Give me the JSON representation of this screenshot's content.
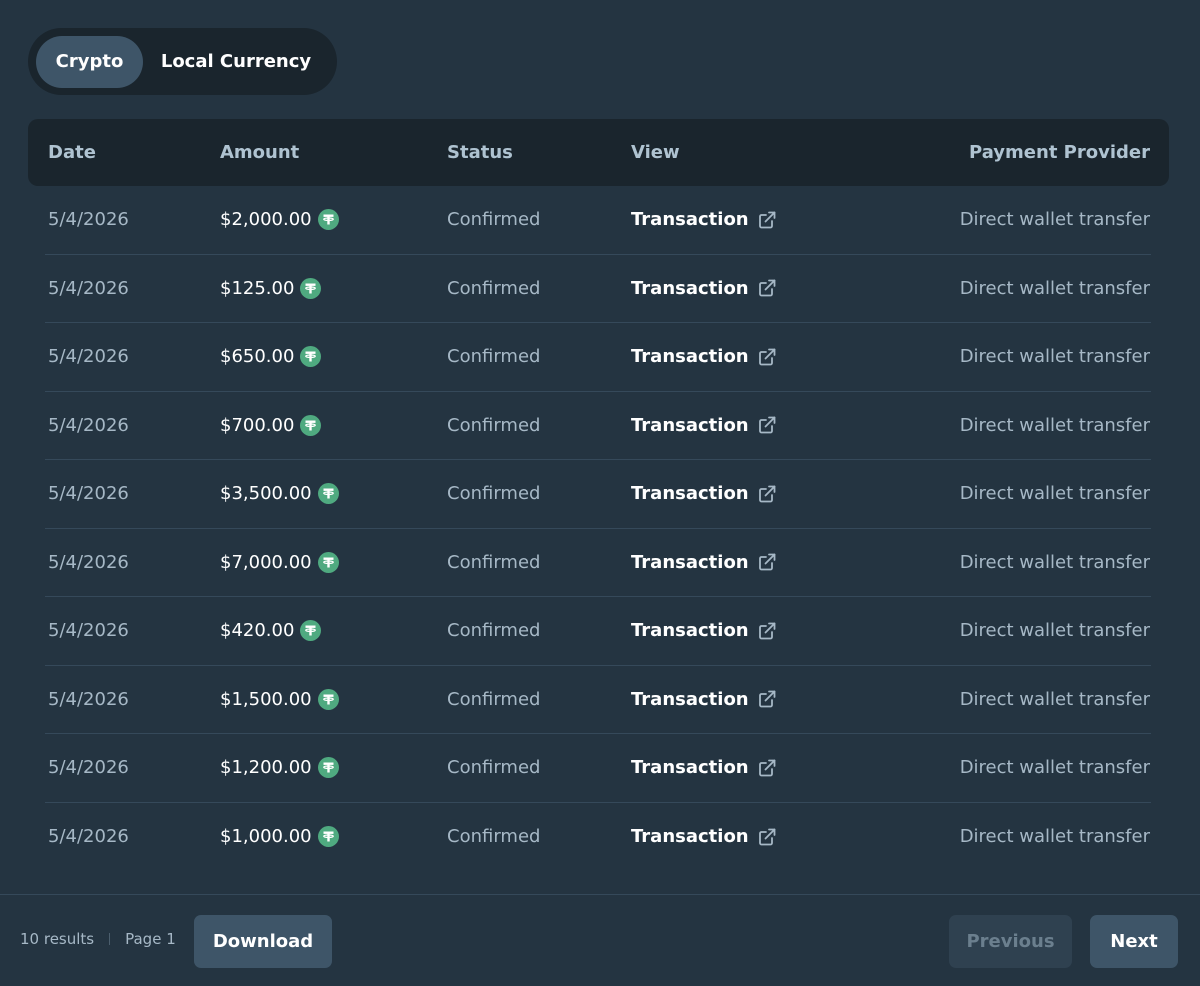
{
  "toggle": {
    "crypto_label": "Crypto",
    "local_label": "Local Currency"
  },
  "table": {
    "headers": {
      "date": "Date",
      "amount": "Amount",
      "status": "Status",
      "view": "View",
      "provider": "Payment Provider"
    },
    "rows": [
      {
        "date": "5/4/2026",
        "amount": "$2,000.00",
        "status": "Confirmed",
        "view": "Transaction",
        "provider": "Direct wallet transfer"
      },
      {
        "date": "5/4/2026",
        "amount": "$125.00",
        "status": "Confirmed",
        "view": "Transaction",
        "provider": "Direct wallet transfer"
      },
      {
        "date": "5/4/2026",
        "amount": "$650.00",
        "status": "Confirmed",
        "view": "Transaction",
        "provider": "Direct wallet transfer"
      },
      {
        "date": "5/4/2026",
        "amount": "$700.00",
        "status": "Confirmed",
        "view": "Transaction",
        "provider": "Direct wallet transfer"
      },
      {
        "date": "5/4/2026",
        "amount": "$3,500.00",
        "status": "Confirmed",
        "view": "Transaction",
        "provider": "Direct wallet transfer"
      },
      {
        "date": "5/4/2026",
        "amount": "$7,000.00",
        "status": "Confirmed",
        "view": "Transaction",
        "provider": "Direct wallet transfer"
      },
      {
        "date": "5/4/2026",
        "amount": "$420.00",
        "status": "Confirmed",
        "view": "Transaction",
        "provider": "Direct wallet transfer"
      },
      {
        "date": "5/4/2026",
        "amount": "$1,500.00",
        "status": "Confirmed",
        "view": "Transaction",
        "provider": "Direct wallet transfer"
      },
      {
        "date": "5/4/2026",
        "amount": "$1,200.00",
        "status": "Confirmed",
        "view": "Transaction",
        "provider": "Direct wallet transfer"
      },
      {
        "date": "5/4/2026",
        "amount": "$1,000.00",
        "status": "Confirmed",
        "view": "Transaction",
        "provider": "Direct wallet transfer"
      }
    ]
  },
  "footer": {
    "results": "10 results",
    "page": "Page 1",
    "download_label": "Download",
    "previous_label": "Previous",
    "next_label": "Next"
  },
  "icons": {
    "currency": "tether-icon",
    "view": "external-link-icon"
  },
  "colors": {
    "background": "#243441",
    "header_bg": "#1a252d",
    "accent": "#3e5568",
    "coin": "#4faa80"
  }
}
